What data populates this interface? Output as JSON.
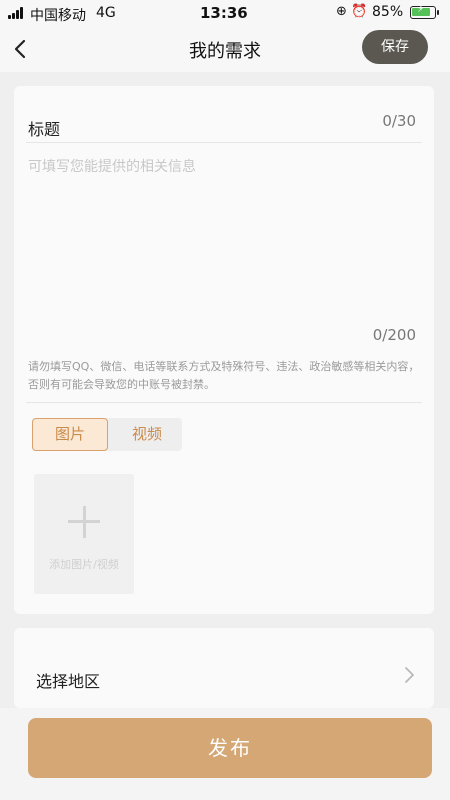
{
  "status_bar": {
    "carrier": "中国移动",
    "network": "4G",
    "time": "13:36",
    "battery_percent": "85%"
  },
  "header": {
    "title": "我的需求",
    "save_label": "保存"
  },
  "form": {
    "title_label": "标题",
    "title_counter": "0/30",
    "content_placeholder": "可填写您能提供的相关信息",
    "content_counter": "0/200",
    "notice": "请勿填写QQ、微信、电话等联系方式及特殊符号、违法、政治敏感等相关内容，否则有可能会导致您的中账号被封禁。",
    "media_tabs": [
      "图片",
      "视频"
    ],
    "selected_tab": "图片",
    "upload_label": "添加图片/视频"
  },
  "region": {
    "label": "选择地区"
  },
  "publish_label": "发布",
  "colors": {
    "accent": "#d4a774",
    "save_button": "#5b5852",
    "tab_text": "#c98b4b"
  }
}
